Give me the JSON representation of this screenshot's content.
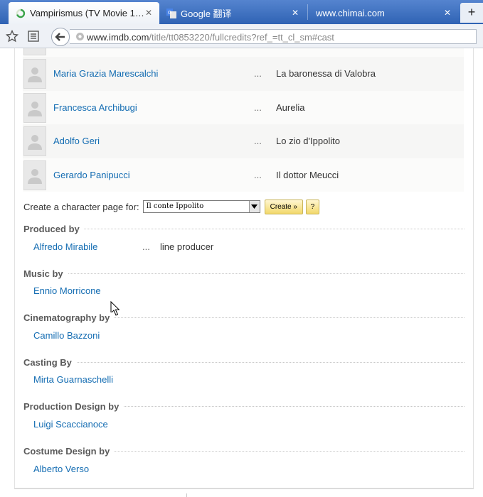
{
  "browser": {
    "tabs": [
      {
        "title": "Vampirismus (TV Movie 1…",
        "active": true,
        "favicon": "loading-spinner-icon"
      },
      {
        "title": "Google 翻译",
        "active": false,
        "favicon": "google-translate-icon"
      },
      {
        "title": "www.chimai.com",
        "active": false,
        "favicon": ""
      }
    ],
    "new_tab_label": "+",
    "close_glyph": "✕",
    "url_host": "www.imdb.com",
    "url_path": "/title/tt0853220/fullcredits?ref_=tt_cl_sm#cast"
  },
  "cast": {
    "rows": [
      {
        "name": "Maria Grazia Marescalchi",
        "dots": "...",
        "character": "La baronessa di Valobra"
      },
      {
        "name": "Francesca Archibugi",
        "dots": "...",
        "character": "Aurelia"
      },
      {
        "name": "Adolfo Geri",
        "dots": "...",
        "character": "Lo zio d'Ippolito"
      },
      {
        "name": "Gerardo Panipucci",
        "dots": "...",
        "character": "Il dottor Meucci"
      }
    ],
    "create_label": "Create a character page for:",
    "select_value": "Il conte Ippolito",
    "create_button": "Create »",
    "help_button": "?"
  },
  "credits": {
    "produced_by": {
      "title": "Produced by",
      "name": "Alfredo Mirabile",
      "dots": "...",
      "role": "line producer"
    },
    "music_by": {
      "title": "Music by",
      "name": "Ennio Morricone"
    },
    "cinematography_by": {
      "title": "Cinematography by",
      "name": "Camillo Bazzoni"
    },
    "casting_by": {
      "title": "Casting By",
      "name": "Mirta Guarnaschelli"
    },
    "production_design_by": {
      "title": "Production Design by",
      "name": "Luigi Scaccianoce"
    },
    "costume_design_by": {
      "title": "Costume Design by",
      "name": "Alberto Verso"
    }
  },
  "colors": {
    "link": "#136cb2",
    "tabbar": "#3f72c2",
    "button_gold": "#f2d86a"
  }
}
